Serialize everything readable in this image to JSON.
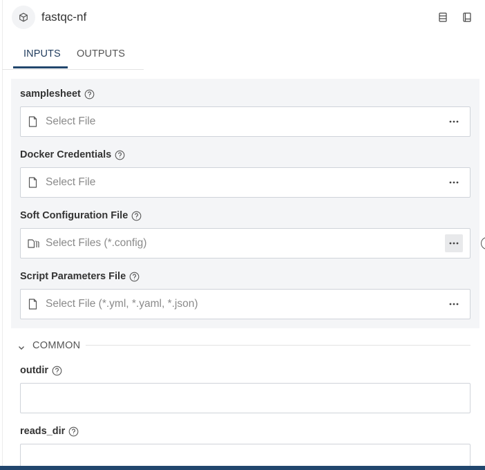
{
  "app": {
    "title": "fastqc-nf",
    "icon": "cube-icon",
    "header_icons": [
      "list-view-icon",
      "notebook-icon"
    ]
  },
  "tabs": [
    {
      "label": "INPUTS",
      "active": true
    },
    {
      "label": "OUTPUTS",
      "active": false
    }
  ],
  "file_inputs": [
    {
      "label": "samplesheet",
      "placeholder": "Select File",
      "icon": "file-icon"
    },
    {
      "label": "Docker Credentials",
      "placeholder": "Select File",
      "icon": "file-icon"
    },
    {
      "label": "Soft Configuration File",
      "placeholder": "Select Files (*.config)",
      "icon": "multi-file-icon"
    },
    {
      "label": "Script Parameters File",
      "placeholder": "Select File (*.yml, *.yaml, *.json)",
      "icon": "file-icon"
    }
  ],
  "common": {
    "title": "COMMON",
    "expanded": true,
    "fields": [
      {
        "label": "outdir",
        "value": ""
      },
      {
        "label": "reads_dir",
        "value": ""
      }
    ]
  },
  "colors": {
    "accent": "#21466d",
    "panel_bg": "#f4f5f7",
    "border": "#cfd3d9",
    "placeholder": "#8a8a8a"
  }
}
